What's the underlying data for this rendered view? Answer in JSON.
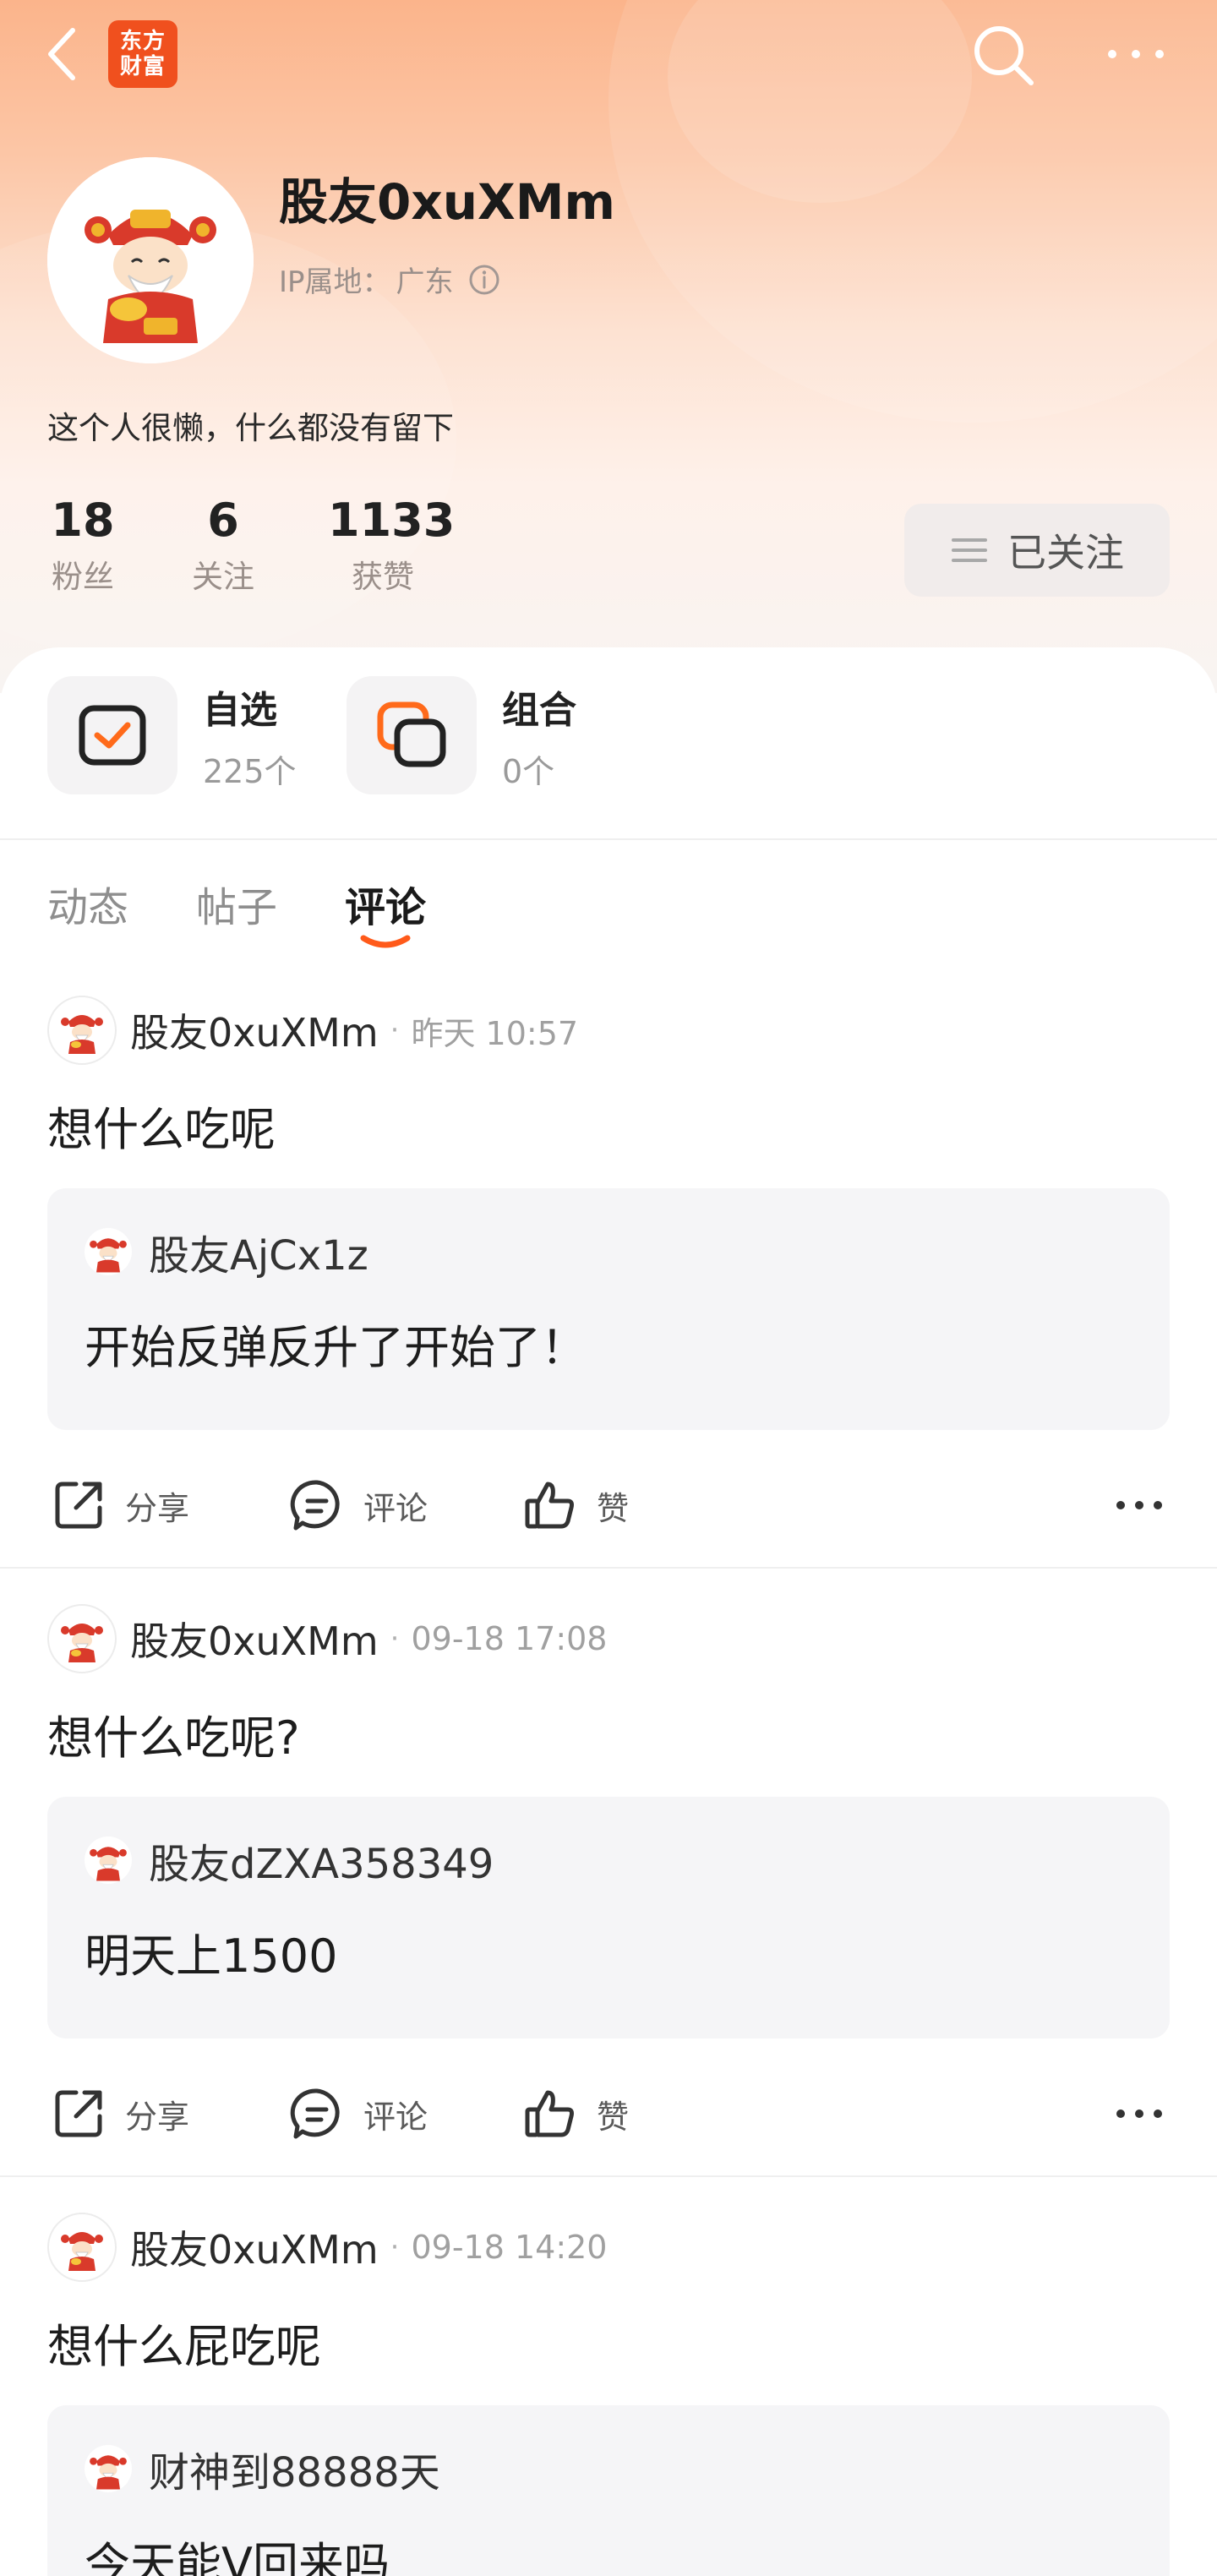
{
  "header": {
    "logo_line1": "东方",
    "logo_line2": "财富"
  },
  "profile": {
    "name": "股友0xuXMm",
    "ip_label": "IP属地：",
    "ip_location": "广东",
    "bio": "这个人很懒，什么都没有留下",
    "stats": [
      {
        "value": "18",
        "label": "粉丝"
      },
      {
        "value": "6",
        "label": "关注"
      },
      {
        "value": "1133",
        "label": "获赞"
      }
    ],
    "follow_button": "已关注"
  },
  "features": [
    {
      "name": "自选",
      "count": "225个"
    },
    {
      "name": "组合",
      "count": "0个"
    }
  ],
  "tabs": [
    {
      "label": "动态",
      "active": false
    },
    {
      "label": "帖子",
      "active": false
    },
    {
      "label": "评论",
      "active": true
    }
  ],
  "actions": {
    "share": "分享",
    "comment": "评论",
    "like": "赞"
  },
  "posts": [
    {
      "author": "股友0xuXMm",
      "time": "昨天 10:57",
      "content": "想什么吃呢",
      "quote": {
        "author": "股友AjCx1z",
        "text": "开始反弹反升了开始了！"
      }
    },
    {
      "author": "股友0xuXMm",
      "time": "09-18 17:08",
      "content": "想什么吃呢?",
      "quote": {
        "author": "股友dZXA358349",
        "text": "明天上1500"
      }
    },
    {
      "author": "股友0xuXMm",
      "time": "09-18 14:20",
      "content": "想什么屁吃呢",
      "quote": {
        "author": "财神到88888天",
        "text": "今天能V回来吗"
      }
    }
  ],
  "colors": {
    "brand": "#f0501e",
    "accent": "#ff6a1a"
  }
}
